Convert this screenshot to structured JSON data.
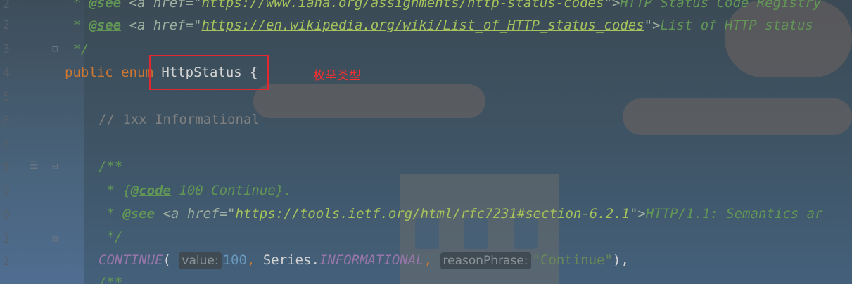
{
  "code": {
    "line1": {
      "star": " * ",
      "tag": "@see",
      "open": " <a href=\"",
      "url": "https://www.iana.org/assignments/http-status-codes",
      "close": "\">",
      "text": "HTTP Status Code Registry"
    },
    "line2": {
      "star": " * ",
      "tag": "@see",
      "open": " <a href=\"",
      "url": "https://en.wikipedia.org/wiki/List_of_HTTP_status_codes",
      "close": "\">",
      "text": "List of HTTP status"
    },
    "line3": " */",
    "line4": {
      "kw1": "public",
      "kw2": "enum",
      "name": "HttpStatus",
      "brace": "{"
    },
    "line6": "// 1xx Informational",
    "line8": "/**",
    "line9": {
      "star": " * ",
      "open": "{",
      "tag": "@code",
      "text": " 100 Continue}."
    },
    "line10": {
      "star": " * ",
      "tag": "@see",
      "open": " <a href=\"",
      "url": "https://tools.ietf.org/html/rfc7231#section-6.2.1",
      "close": "\">",
      "text": "HTTP/1.1: Semantics ar"
    },
    "line11": " */",
    "line12": {
      "const": "CONTINUE",
      "paren": "(",
      "hint1": "value:",
      "num": "100",
      "comma1": ", ",
      "series": "Series.",
      "series_const": "INFORMATIONAL",
      "comma2": ",",
      "hint2": "reasonPhrase:",
      "str": "\"Continue\"",
      "end": "),"
    },
    "line13": "/**"
  },
  "gutter": [
    "2",
    "2",
    "3",
    "4",
    "5",
    "6",
    "7",
    "8",
    "9",
    "0",
    "1",
    "2"
  ],
  "annotation": "枚举类型",
  "colors": {
    "highlight_border": "#e0282e",
    "annotation_text": "#ff2d2d"
  }
}
